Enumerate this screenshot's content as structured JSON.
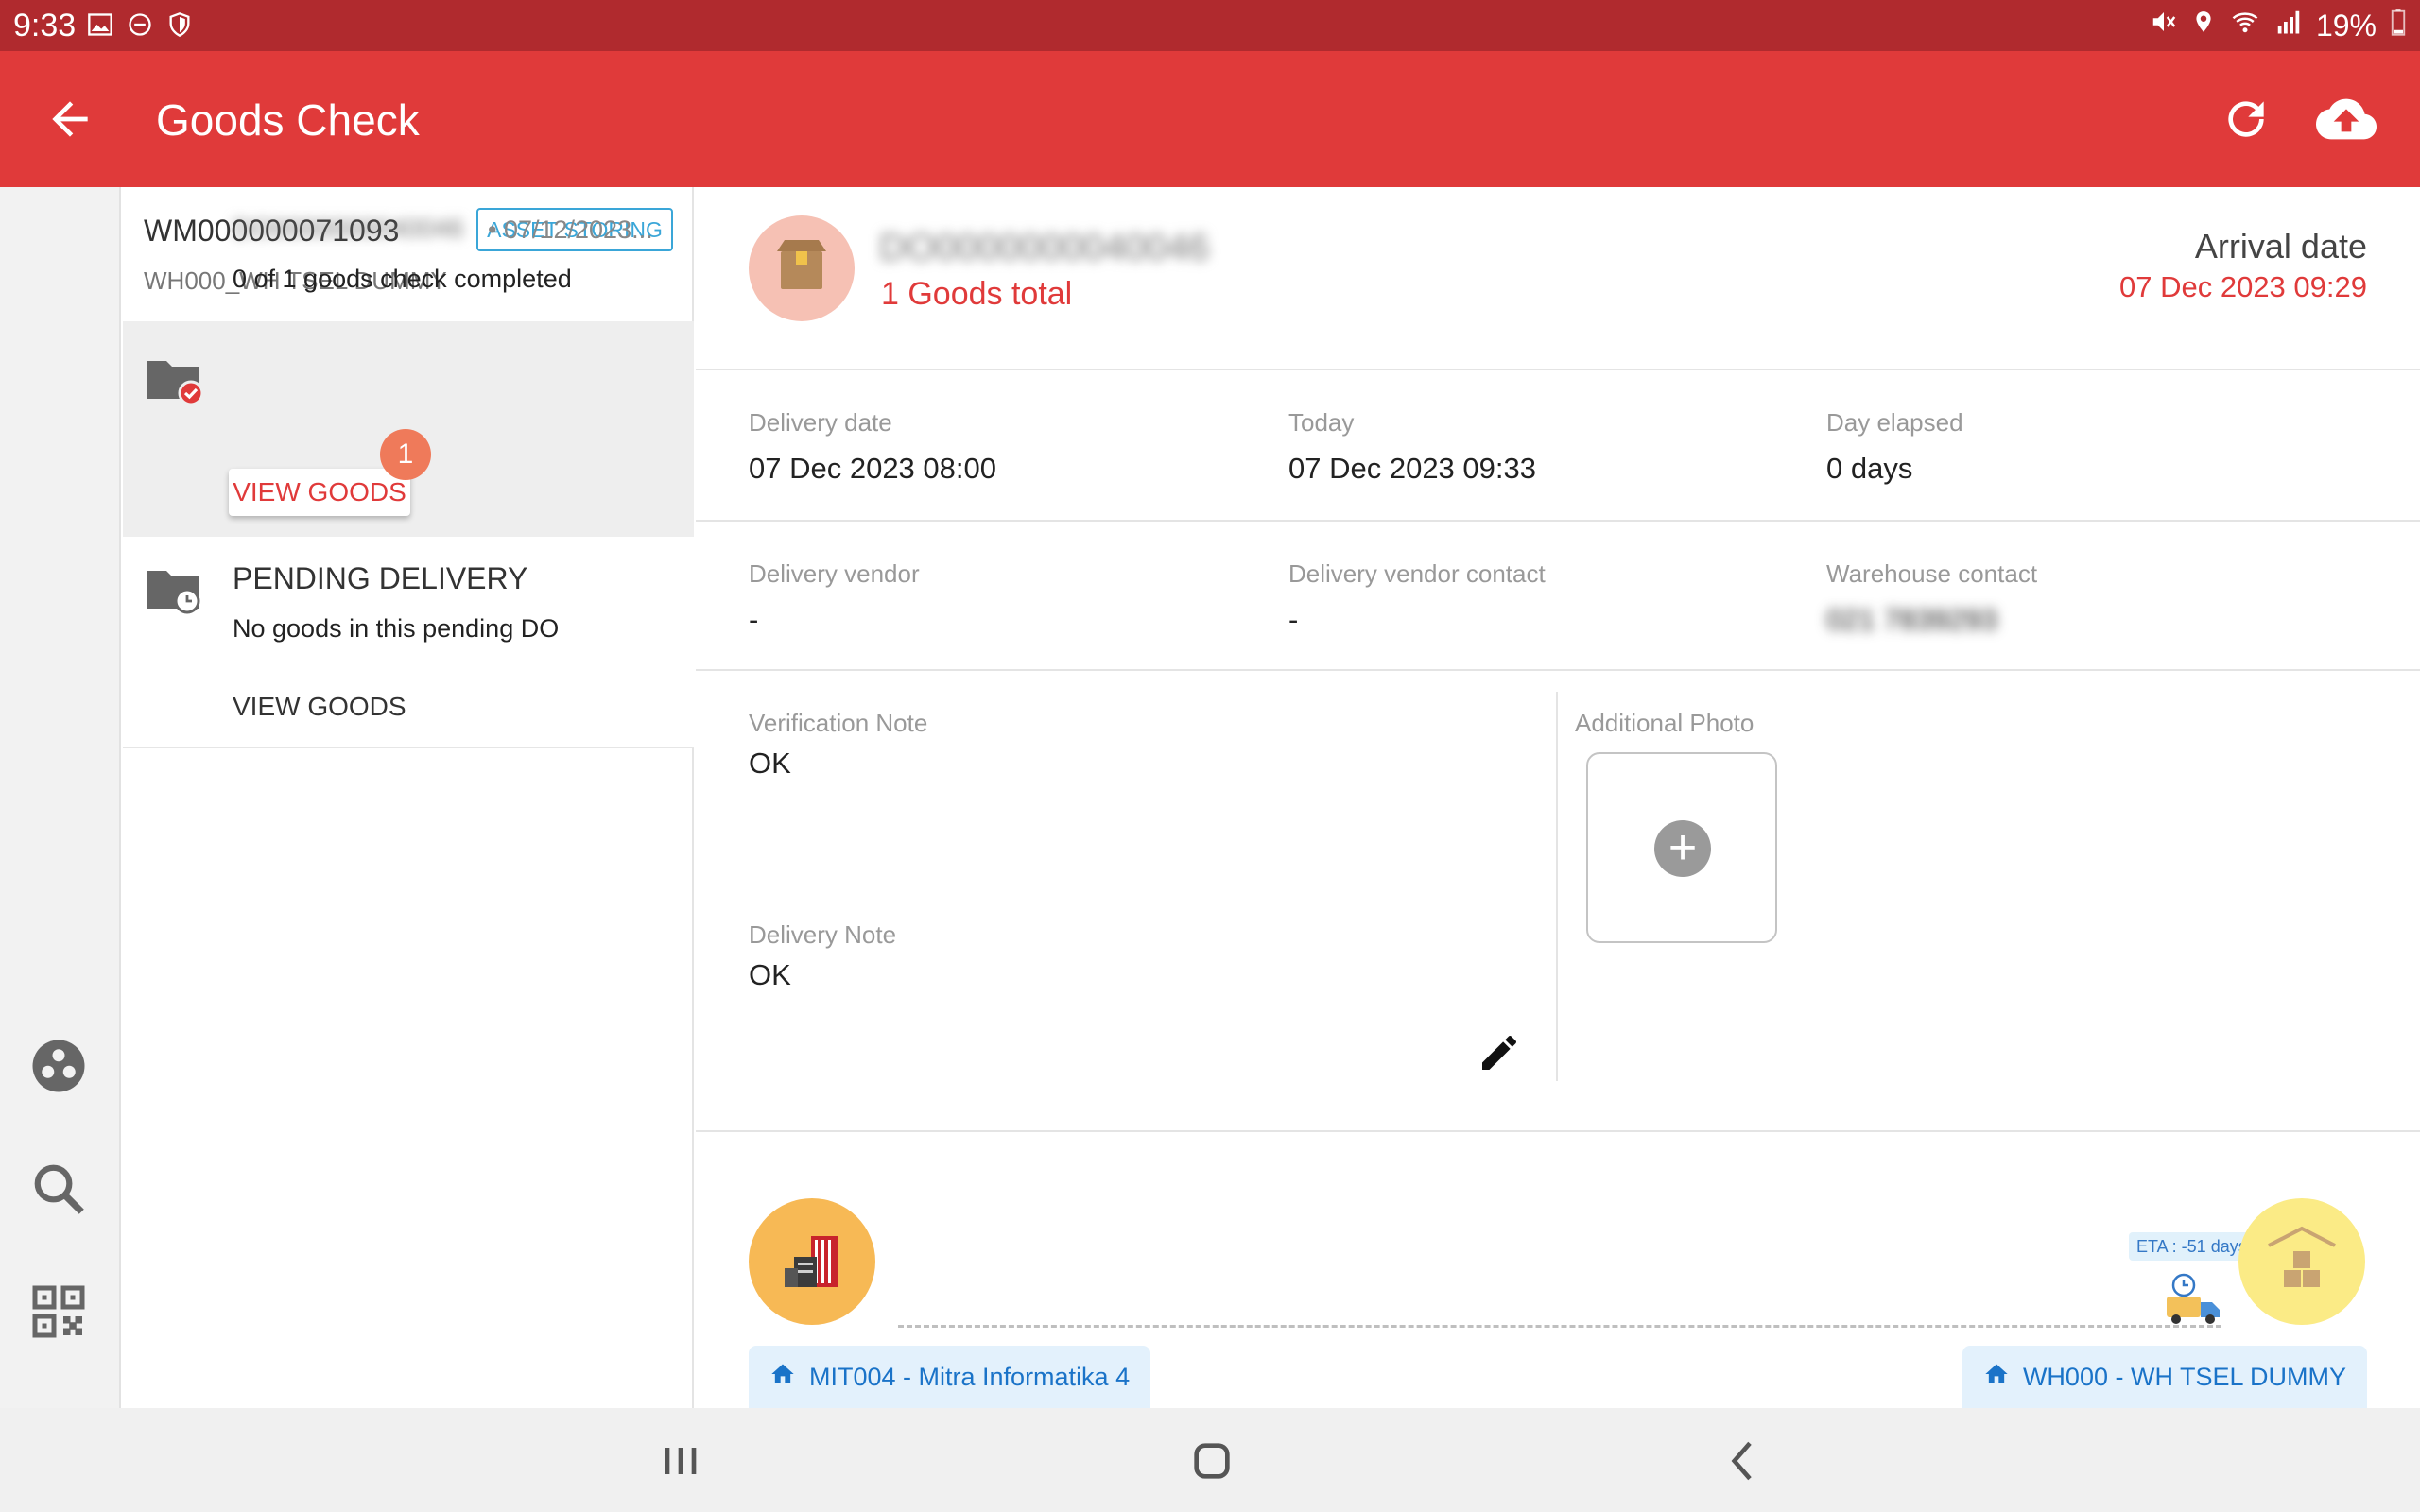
{
  "status_bar": {
    "time": "9:33",
    "battery": "19%",
    "left_icons": [
      "image-icon",
      "dnd-icon",
      "shield-icon"
    ],
    "right_icons": [
      "mute-icon",
      "location-icon",
      "wifi-icon",
      "signal-icon",
      "battery-icon"
    ]
  },
  "app_bar": {
    "title": "Goods Check",
    "back_icon": "arrow-back-icon",
    "actions": [
      "refresh-icon",
      "cloud-upload-icon"
    ],
    "color": "#e03a3a"
  },
  "rail": {
    "items": [
      "group-icon",
      "search-icon",
      "qr-code-icon"
    ]
  },
  "list": {
    "wm_id": "WM000000071093",
    "warehouse": "WH000_WH TSEL DUMMY",
    "chip": "ASSET STORING",
    "do_item": {
      "title": "DO0000000040046",
      "date": "• 07/12/2023...",
      "status": "0 of  1 goods check completed",
      "badge": "1",
      "button": "VIEW GOODS"
    },
    "pending": {
      "title": "PENDING DELIVERY",
      "subtitle": "No goods in this pending DO",
      "button": "VIEW GOODS"
    }
  },
  "detail": {
    "do_number": "DO0000000040046",
    "goods_total": "1 Goods total",
    "arrival_label": "Arrival date",
    "arrival_date": "07 Dec 2023 09:29",
    "delivery_date_label": "Delivery date",
    "delivery_date": "07 Dec 2023 08:00",
    "today_label": "Today",
    "today": "07 Dec 2023 09:33",
    "elapsed_label": "Day elapsed",
    "elapsed": "0 days",
    "vendor_label": "Delivery vendor",
    "vendor": "-",
    "vendor_contact_label": "Delivery vendor contact",
    "vendor_contact": "-",
    "wh_contact_label": "Warehouse contact",
    "wh_contact": "021 7839293",
    "verification_label": "Verification Note",
    "verification": "OK",
    "delivery_note_label": "Delivery Note",
    "delivery_note": "OK",
    "photo_label": "Additional Photo",
    "eta": "ETA : -51 days",
    "origin": "MIT004 - Mitra Informatika 4",
    "destination": "WH000 - WH TSEL DUMMY"
  },
  "nav_bar": {
    "buttons": [
      "recents-icon",
      "home-icon",
      "back-icon"
    ]
  }
}
